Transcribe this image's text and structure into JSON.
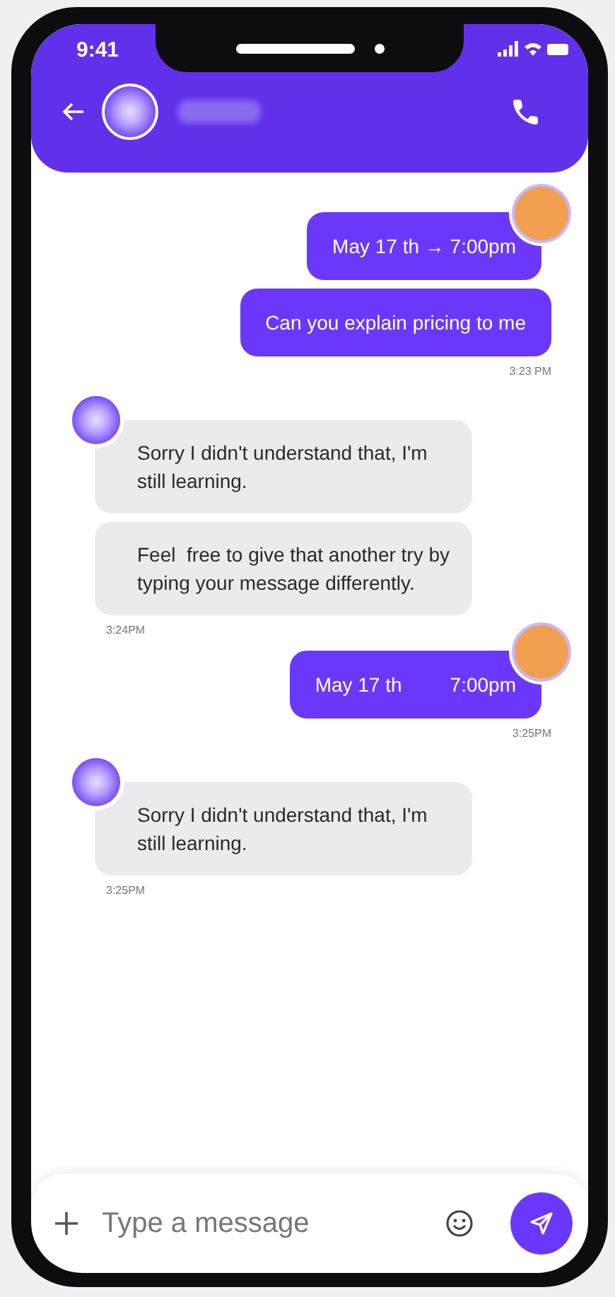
{
  "status_bar": {
    "time": "9:41"
  },
  "composer": {
    "placeholder": "Type a message"
  },
  "groups": [
    {
      "kind": "sent",
      "bubbles": [
        {
          "texts": [
            "May 17 th → 7:00pm"
          ]
        },
        {
          "texts": [
            "Can you explain pricing to me"
          ]
        }
      ],
      "time": "3:23 PM"
    },
    {
      "kind": "received",
      "bubbles": [
        {
          "texts": [
            "Sorry I didn't understand that, I'm still learning."
          ]
        },
        {
          "texts": [
            "Feel  free to give that another try by typing your message differently."
          ]
        }
      ],
      "time": "3:24PM"
    },
    {
      "kind": "sent",
      "bubbles": [
        {
          "texts": [
            "May 17 th",
            "7:00pm"
          ]
        }
      ],
      "time": "3:25PM"
    },
    {
      "kind": "received",
      "bubbles": [
        {
          "texts": [
            "Sorry I didn't understand that, I'm still learning."
          ]
        }
      ],
      "time": "3:25PM"
    }
  ]
}
